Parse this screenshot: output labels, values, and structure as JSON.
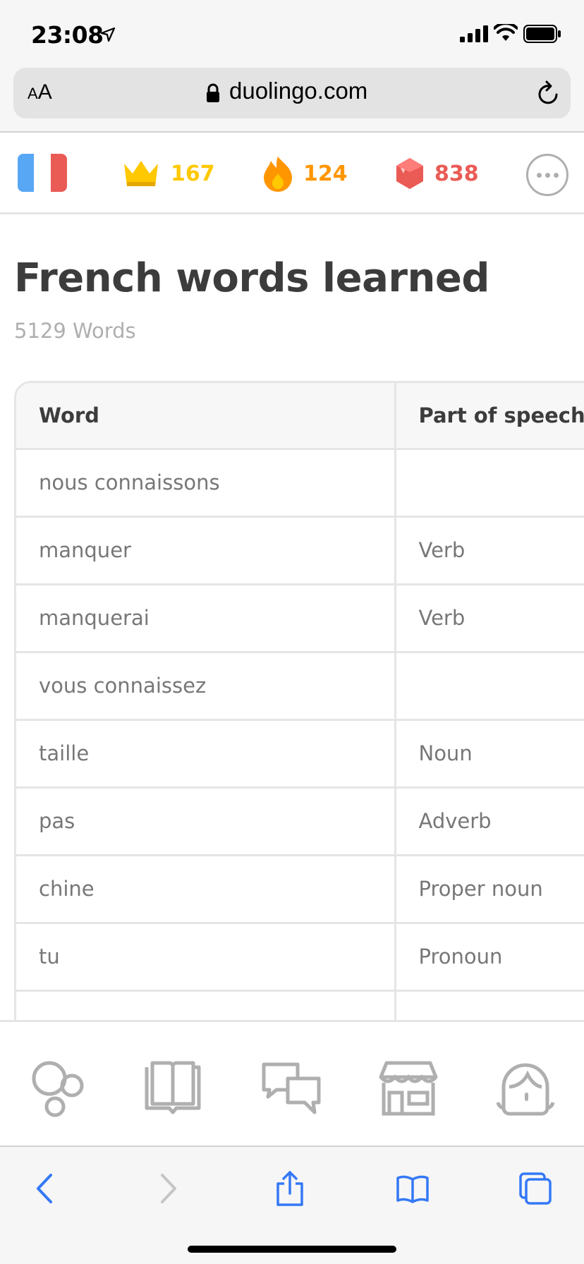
{
  "status_bar": {
    "time": "23:08"
  },
  "browser": {
    "aa_small": "A",
    "aa_large": "A",
    "url": "duolingo.com"
  },
  "duo_header": {
    "crowns": "167",
    "streak": "124",
    "gems": "838",
    "colors": {
      "crown": "#ffc800",
      "streak": "#ff9600",
      "gems": "#ea5b56"
    }
  },
  "page": {
    "title": "French words learned",
    "count": "5129 Words"
  },
  "table": {
    "headers": [
      "Word",
      "Part of speech"
    ],
    "rows": [
      {
        "word": "nous connaissons",
        "pos": ""
      },
      {
        "word": "manquer",
        "pos": "Verb"
      },
      {
        "word": "manquerai",
        "pos": "Verb"
      },
      {
        "word": "vous connaissez",
        "pos": ""
      },
      {
        "word": "taille",
        "pos": "Noun"
      },
      {
        "word": "pas",
        "pos": "Adverb"
      },
      {
        "word": "chine",
        "pos": "Proper noun"
      },
      {
        "word": "tu",
        "pos": "Pronoun"
      },
      {
        "word": "",
        "pos": ""
      }
    ]
  },
  "tabs": [
    "learn-tab",
    "stories-tab",
    "discuss-tab",
    "shop-tab",
    "profile-tab"
  ],
  "icons": [
    "location-arrow-icon",
    "signal-icon",
    "wifi-icon",
    "battery-icon",
    "lock-icon",
    "reload-icon",
    "flag-icon",
    "crown-icon",
    "fire-icon",
    "gem-icon",
    "more-icon",
    "back-icon",
    "forward-icon",
    "share-icon",
    "bookmarks-icon",
    "tabs-icon"
  ]
}
